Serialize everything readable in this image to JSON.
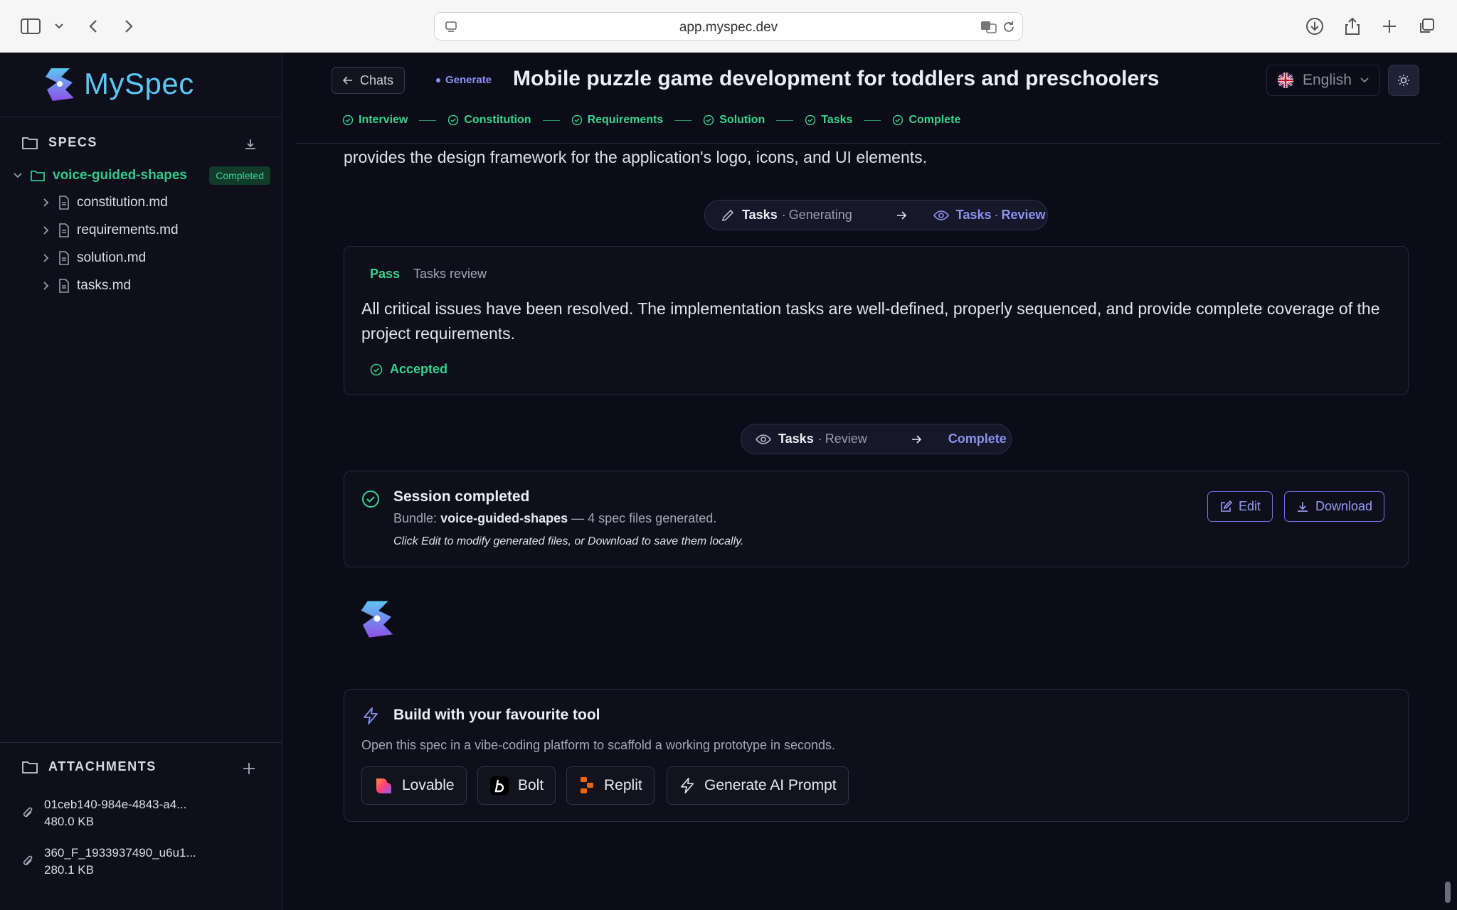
{
  "browser": {
    "url": "app.myspec.dev"
  },
  "sidebar": {
    "brand": "MySpec",
    "specs_heading": "SPECS",
    "bundle": {
      "name": "voice-guided-shapes",
      "status": "Completed"
    },
    "files": [
      {
        "name": "constitution.md"
      },
      {
        "name": "requirements.md"
      },
      {
        "name": "solution.md"
      },
      {
        "name": "tasks.md"
      }
    ],
    "attachments_heading": "ATTACHMENTS",
    "attachments": [
      {
        "name": "01ceb140-984e-4843-a4...",
        "size": "480.0 KB"
      },
      {
        "name": "360_F_1933937490_u6u1...",
        "size": "280.1 KB"
      }
    ]
  },
  "header": {
    "back_label": "Chats",
    "mode_tag": "Generate",
    "title": "Mobile puzzle game development for toddlers and preschoolers",
    "language": "English",
    "steps": [
      "Interview",
      "Constitution",
      "Requirements",
      "Solution",
      "Tasks",
      "Complete"
    ]
  },
  "content": {
    "intro_tail": "provides the design framework for the application's logo, icons, and UI elements.",
    "transition1": {
      "from_label": "Tasks",
      "from_sub": "Generating",
      "to_label": "Tasks",
      "to_sub": "Review"
    },
    "review": {
      "verdict": "Pass",
      "label": "Tasks review",
      "body": "All critical issues have been resolved. The implementation tasks are well-defined, properly sequenced, and provide complete coverage of the project requirements.",
      "status": "Accepted"
    },
    "transition2": {
      "from_label": "Tasks",
      "from_sub": "Review",
      "to_label": "Complete"
    },
    "session": {
      "title": "Session completed",
      "bundle_prefix": "Bundle:",
      "bundle_name": "voice-guided-shapes",
      "bundle_suffix": "— 4 spec files generated.",
      "note": "Click Edit to modify generated files, or Download to save them locally.",
      "edit_label": "Edit",
      "download_label": "Download"
    },
    "build": {
      "title": "Build with your favourite tool",
      "subtitle": "Open this spec in a vibe-coding platform to scaffold a working prototype in seconds.",
      "tools": [
        "Lovable",
        "Bolt",
        "Replit",
        "Generate AI Prompt"
      ]
    }
  },
  "colors": {
    "accent": "#8a92f2",
    "success": "#3bd18c",
    "background": "#0b0c17"
  }
}
